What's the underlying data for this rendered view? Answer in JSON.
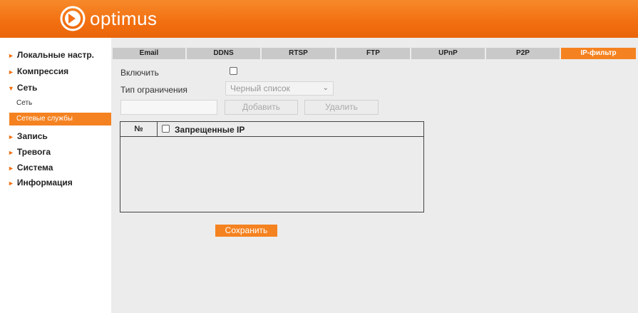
{
  "header": {
    "logo_text": "optimus",
    "accent": "#f37016"
  },
  "sidebar": {
    "items": [
      {
        "label": "Локальные настр."
      },
      {
        "label": "Компрессия"
      },
      {
        "label": "Сеть"
      },
      {
        "label": "Запись"
      },
      {
        "label": "Тревога"
      },
      {
        "label": "Система"
      },
      {
        "label": "Информация"
      }
    ],
    "sub_items": [
      {
        "label": "Сеть"
      },
      {
        "label": "Сетевые службы"
      }
    ]
  },
  "tabs": [
    {
      "label": "Email"
    },
    {
      "label": "DDNS"
    },
    {
      "label": "RTSP"
    },
    {
      "label": "FTP"
    },
    {
      "label": "UPnP"
    },
    {
      "label": "P2P"
    },
    {
      "label": "IP-фильтр"
    }
  ],
  "form": {
    "enable_label": "Включить",
    "enable_checked": false,
    "restriction_label": "Тип ограничения",
    "restriction_value": "Черный список",
    "ip_input_value": "",
    "add_label": "Добавить",
    "delete_label": "Удалить"
  },
  "table": {
    "col_num": "№",
    "col_ip": "Запрещенные IP",
    "rows": []
  },
  "save_label": "Сохранить"
}
